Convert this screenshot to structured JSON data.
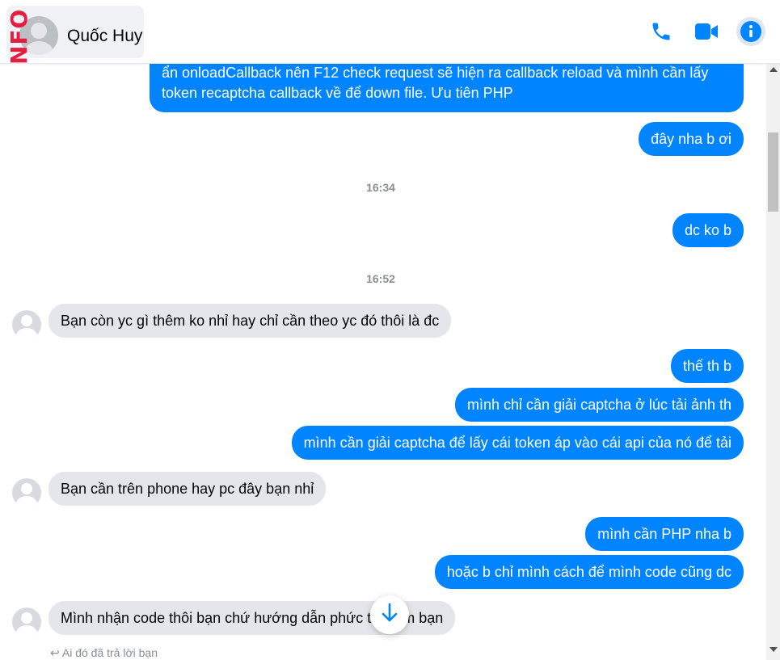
{
  "colors": {
    "accent": "#0084ff",
    "incoming_bubble": "#e4e6eb",
    "timestamp": "#8a8d91",
    "overlay": "#e41e3f"
  },
  "header": {
    "contact_name": "Quốc Huy",
    "overlay_text": "NFO",
    "icons": [
      "phone-icon",
      "video-camera-icon",
      "info-icon"
    ]
  },
  "messages": [
    {
      "side": "out",
      "text_line1": "ẩn onloadCallback nên F12 check request sẽ hiện ra callback reload và mình cần lấy",
      "text_line2": "token recaptcha callback về để down file. Ưu tiên PHP"
    },
    {
      "side": "out",
      "text": "đây nha b ơi"
    },
    {
      "type": "timestamp",
      "text": "16:34"
    },
    {
      "side": "out",
      "text": "dc ko b"
    },
    {
      "type": "timestamp",
      "text": "16:52"
    },
    {
      "side": "in",
      "text": "Bạn còn yc gì thêm ko nhỉ hay chỉ cần theo yc đó thôi là đc"
    },
    {
      "side": "out",
      "text": "thế th b"
    },
    {
      "side": "out",
      "text": "mình chỉ cần giải captcha ở lúc tải ảnh th"
    },
    {
      "side": "out",
      "text": "mình cần giải captcha để lấy cái token áp vào cái api của nó để tải"
    },
    {
      "side": "in",
      "text": "Bạn cần trên phone hay pc đây bạn nhỉ"
    },
    {
      "side": "out",
      "text": "mình cần PHP nha b"
    },
    {
      "side": "out",
      "text": "hoặc b chỉ mình cách để mình code cũng dc"
    },
    {
      "side": "in",
      "text": "Mình nhận code thôi bạn chứ hướng dẫn phức tạp lắm bạn"
    }
  ],
  "reply_hint": "Ai đó đã trả lời bạn"
}
